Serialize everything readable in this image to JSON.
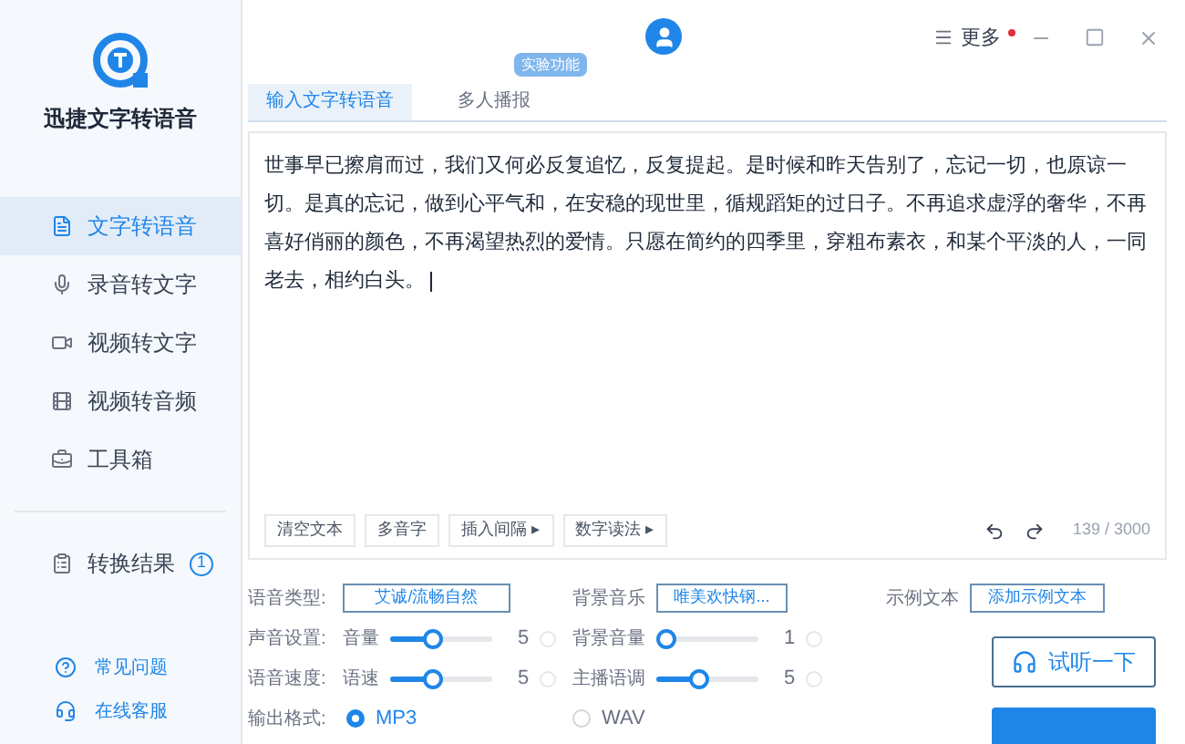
{
  "app": {
    "title": "迅捷文字转语音"
  },
  "sidebar": {
    "items": [
      {
        "label": "文字转语音",
        "selected": true
      },
      {
        "label": "录音转文字",
        "selected": false
      },
      {
        "label": "视频转文字",
        "selected": false
      },
      {
        "label": "视频转音频",
        "selected": false
      },
      {
        "label": "工具箱",
        "selected": false
      }
    ],
    "results": {
      "label": "转换结果",
      "count": "1"
    },
    "links": [
      "常见问题",
      "在线客服"
    ]
  },
  "topbar": {
    "more": {
      "label": "更多",
      "notification": true
    }
  },
  "tabs": [
    {
      "label": "输入文字转语音",
      "selected": true
    },
    {
      "label": "多人播报",
      "selected": false,
      "badge": "实验功能"
    }
  ],
  "editor": {
    "text": "世事早已擦肩而过，我们又何必反复追忆，反复提起。是时候和昨天告别了，忘记一切，也原谅一切。是真的忘记，做到心平气和，在安稳的现世里，循规蹈矩的过日子。不再追求虚浮的奢华，不再喜好俏丽的颜色，不再渴望热烈的爱情。只愿在简约的四季里，穿粗布素衣，和某个平淡的人，一同老去，相约白头。",
    "tools": [
      {
        "label": "清空文本"
      },
      {
        "label": "多音字"
      },
      {
        "label": "插入间隔",
        "caret": "▸"
      },
      {
        "label": "数字读法",
        "caret": "▸"
      }
    ],
    "counter": "139 / 3000"
  },
  "settings": {
    "voice_type": {
      "label": "语音类型:",
      "value": "艾诚/流畅自然"
    },
    "background_music": {
      "label": "背景音乐",
      "value": "唯美欢快钢..."
    },
    "sample_text": {
      "label": "示例文本",
      "button": "添加示例文本"
    },
    "sliders": [
      {
        "group": "声音设置:",
        "name": "音量",
        "level": 0.4,
        "reading": "5"
      },
      {
        "group": "语音速度:",
        "name": "语速",
        "level": 0.4,
        "reading": "5"
      },
      {
        "name": "背景音量",
        "level": 0,
        "reading": "1"
      },
      {
        "name": "主播语调",
        "level": 0.4,
        "reading": "5"
      }
    ],
    "output_format": {
      "label": "输出格式:",
      "options": [
        {
          "label": "MP3",
          "selected": true
        },
        {
          "label": "WAV",
          "selected": false
        }
      ]
    },
    "preview_button": "试听一下"
  }
}
